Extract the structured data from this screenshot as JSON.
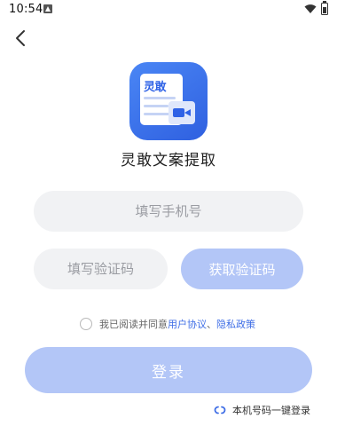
{
  "status_bar": {
    "time": "10:54"
  },
  "app": {
    "name": "灵敢文案提取",
    "logo_text": "灵敢"
  },
  "form": {
    "phone_placeholder": "填写手机号",
    "code_placeholder": "填写验证码",
    "get_code_label": "获取验证码"
  },
  "agreement": {
    "prefix": "我已阅读并同意",
    "user_agreement": "用户协议",
    "separator": "、",
    "privacy_policy": "隐私政策"
  },
  "login_label": "登录",
  "one_key_login": "本机号码一键登录",
  "colors": {
    "accent": "#3f6ee6",
    "button_disabled": "#b3c6f7",
    "input_bg": "#f1f2f4"
  }
}
